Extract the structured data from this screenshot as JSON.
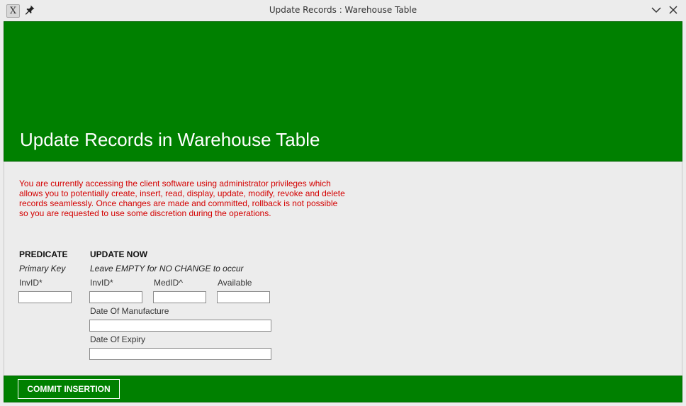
{
  "window": {
    "title": "Update Records : Warehouse Table",
    "app_icon_glyph": "X",
    "icons": [
      "app-icon",
      "pin-icon",
      "minimize-chevron-icon",
      "close-icon"
    ]
  },
  "header": {
    "title": "Update Records in Warehouse Table",
    "background_color": "#008000"
  },
  "warning": {
    "text": "You are currently accessing the client software using administrator privileges which allows you to potentially create, insert, read, display, update, modify, revoke and delete records seamlessly. Once changes are made and committed, rollback is not possible so you are requested to use some discretion during the operations.",
    "color": "#d40000"
  },
  "predicate": {
    "heading": "PREDICATE",
    "subheading": "Primary Key",
    "fields": {
      "invid": {
        "label": "InvID*",
        "value": ""
      }
    }
  },
  "update": {
    "heading": "UPDATE NOW",
    "subheading": "Leave EMPTY for NO CHANGE to occur",
    "fields": {
      "invid": {
        "label": "InvID*",
        "value": ""
      },
      "medid": {
        "label": "MedID^",
        "value": ""
      },
      "available": {
        "label": "Available",
        "value": ""
      },
      "date_of_manufacture": {
        "label": "Date Of Manufacture",
        "value": ""
      },
      "date_of_expiry": {
        "label": "Date Of Expiry",
        "value": ""
      }
    }
  },
  "footer": {
    "commit_label": "COMMIT INSERTION",
    "background_color": "#008000"
  }
}
